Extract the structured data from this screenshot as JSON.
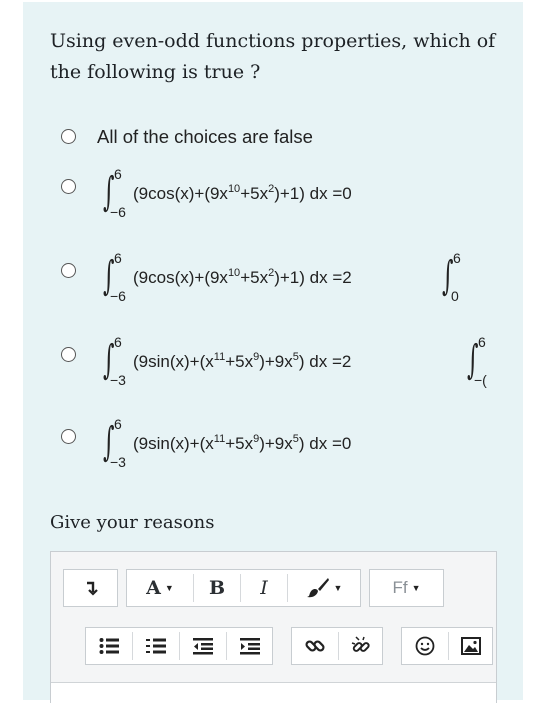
{
  "question": {
    "text": "Using even-odd functions properties, which of the following is true ?"
  },
  "options": [
    {
      "text": "All of the choices are false"
    },
    {
      "upper": "6",
      "lower": "−6",
      "integrand_a": "(9cos(x)+(9x",
      "exp1": "10",
      "integrand_b": "+5x",
      "exp2": "2",
      "integrand_c": ")+1) dx",
      "rhs": "=0"
    },
    {
      "upper": "6",
      "lower": "−6",
      "integrand_a": "(9cos(x)+(9x",
      "exp1": "10",
      "integrand_b": "+5x",
      "exp2": "2",
      "integrand_c": ")+1) dx",
      "rhs": "=2",
      "rhs_upper": "6",
      "rhs_lower": "0"
    },
    {
      "upper": "6",
      "lower": "−3",
      "integrand_a": "(9sin(x)+(x",
      "exp1": "11",
      "integrand_b": "+5x",
      "exp2": "9",
      "integrand_c": ")+9x",
      "exp3": "5",
      "integrand_d": ") dx",
      "rhs": "=2",
      "rhs_upper": "6",
      "rhs_lower": "−("
    },
    {
      "upper": "6",
      "lower": "−3",
      "integrand_a": "(9sin(x)+(x",
      "exp1": "11",
      "integrand_b": "+5x",
      "exp2": "9",
      "integrand_c": ")+9x",
      "exp3": "5",
      "integrand_d": ") dx",
      "rhs": "=0"
    }
  ],
  "reasons_label": "Give your reasons",
  "toolbar": {
    "paragraph_icon": "arrow-down-icon",
    "font_label": "A",
    "bold_label": "B",
    "italic_label": "I",
    "brush_icon": "paint-brush-icon",
    "font_family_label": "Ff",
    "row2_icons": [
      "unordered-list-icon",
      "ordered-list-icon",
      "outdent-icon",
      "indent-icon",
      "link-icon",
      "unlink-icon",
      "emoji-icon",
      "image-icon"
    ]
  }
}
